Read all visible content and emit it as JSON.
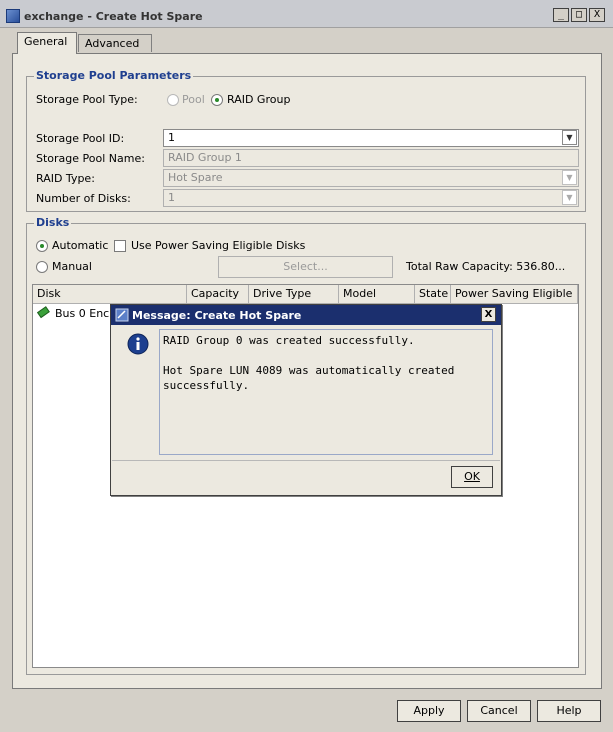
{
  "window": {
    "title": "exchange - Create Hot Spare",
    "buttons": [
      "_",
      "□",
      "X"
    ]
  },
  "tabs": [
    {
      "label": "General",
      "active": true
    },
    {
      "label": "Advanced",
      "active": false
    }
  ],
  "storage_pool": {
    "group_title": "Storage Pool Parameters",
    "type_label": "Storage Pool Type:",
    "type_options": [
      "Pool",
      "RAID Group"
    ],
    "type_selected": "RAID Group",
    "id_label": "Storage Pool ID:",
    "id_value": "1",
    "name_label": "Storage Pool Name:",
    "name_value": "RAID Group 1",
    "raid_type_label": "RAID Type:",
    "raid_type_value": "Hot Spare",
    "num_disks_label": "Number of Disks:",
    "num_disks_value": "1"
  },
  "disks": {
    "group_title": "Disks",
    "automatic_label": "Automatic",
    "manual_label": "Manual",
    "selected_mode": "Automatic",
    "power_saving_label": "Use Power Saving Eligible Disks",
    "power_saving_checked": false,
    "select_button": "Select...",
    "total_raw_capacity": "Total Raw Capacity: 536.80...",
    "columns": [
      "Disk",
      "Capacity",
      "Drive Type",
      "Model",
      "State",
      "Power Saving Eligible"
    ],
    "rows": [
      {
        "disk": "Bus 0 Enc"
      }
    ]
  },
  "dialog": {
    "title": "Message: Create Hot Spare",
    "close": "X",
    "message": "RAID Group 0 was created successfully.\n\nHot Spare LUN 4089 was automatically created\nsuccessfully.",
    "ok_label": "OK"
  },
  "footer": {
    "apply": "Apply",
    "cancel": "Cancel",
    "help": "Help"
  },
  "colors": {
    "dialog_title_bg": "#1b2f6e",
    "group_title": "#1f3f8f",
    "radio_on": "#2a8a2a",
    "title_strip": "#c0392b"
  }
}
